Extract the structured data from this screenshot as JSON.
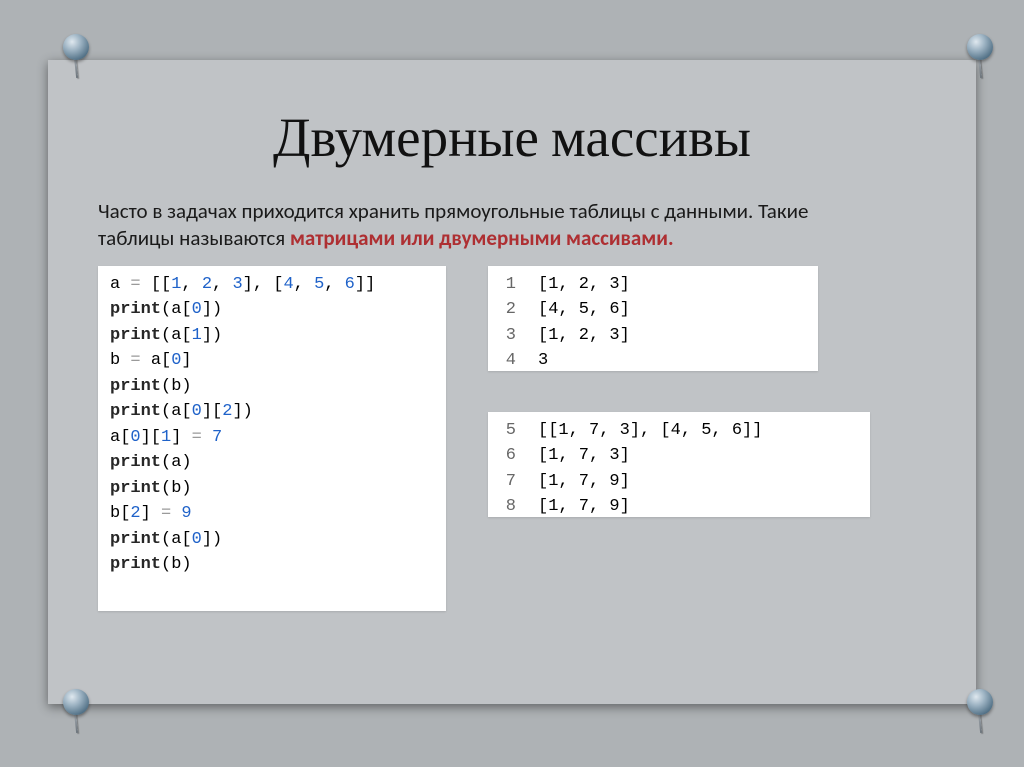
{
  "title": "Двумерные массивы",
  "intro_plain": "Часто в задачах приходится хранить прямоугольные таблицы с данными. Такие таблицы называются ",
  "intro_highlight": "матрицами или двумерными массивами.",
  "code": {
    "l1_a": "a ",
    "l1_b": "[[",
    "l1_v1": "1",
    "l1_v2": "2",
    "l1_v3": "3",
    "l1_c": "], [",
    "l1_v4": "4",
    "l1_v5": "5",
    "l1_v6": "6",
    "l1_d": "]]",
    "l2_a": "print",
    "l2_b": "(a[",
    "l2_n": "0",
    "l2_c": "])",
    "l3_n": "1",
    "l4_a": "b ",
    "l4_b": "a[",
    "l4_n": "0",
    "l4_c": "]",
    "l5": "(b)",
    "l6_b": "(a[",
    "l6_n1": "0",
    "l6_m": "][",
    "l6_n2": "2",
    "l6_c": "])",
    "l7_a": "a[",
    "l7_n1": "0",
    "l7_m": "][",
    "l7_n2": "1",
    "l7_b": "] ",
    "l7_v": "7",
    "l8": "(a)",
    "l10_a": "b[",
    "l10_n": "2",
    "l10_b": "] ",
    "l10_v": "9"
  },
  "out1": {
    "r1n": "1",
    "r1v": "[1, 2, 3]",
    "r2n": "2",
    "r2v": "[4, 5, 6]",
    "r3n": "3",
    "r3v": "[1, 2, 3]",
    "r4n": "4",
    "r4v": "3"
  },
  "out2": {
    "r1n": "5",
    "r1v": "[[1, 7, 3], [4, 5, 6]]",
    "r2n": "6",
    "r2v": "[1, 7, 3]",
    "r3n": "7",
    "r3v": "[1, 7, 9]",
    "r4n": "8",
    "r4v": "[1, 7, 9]"
  }
}
